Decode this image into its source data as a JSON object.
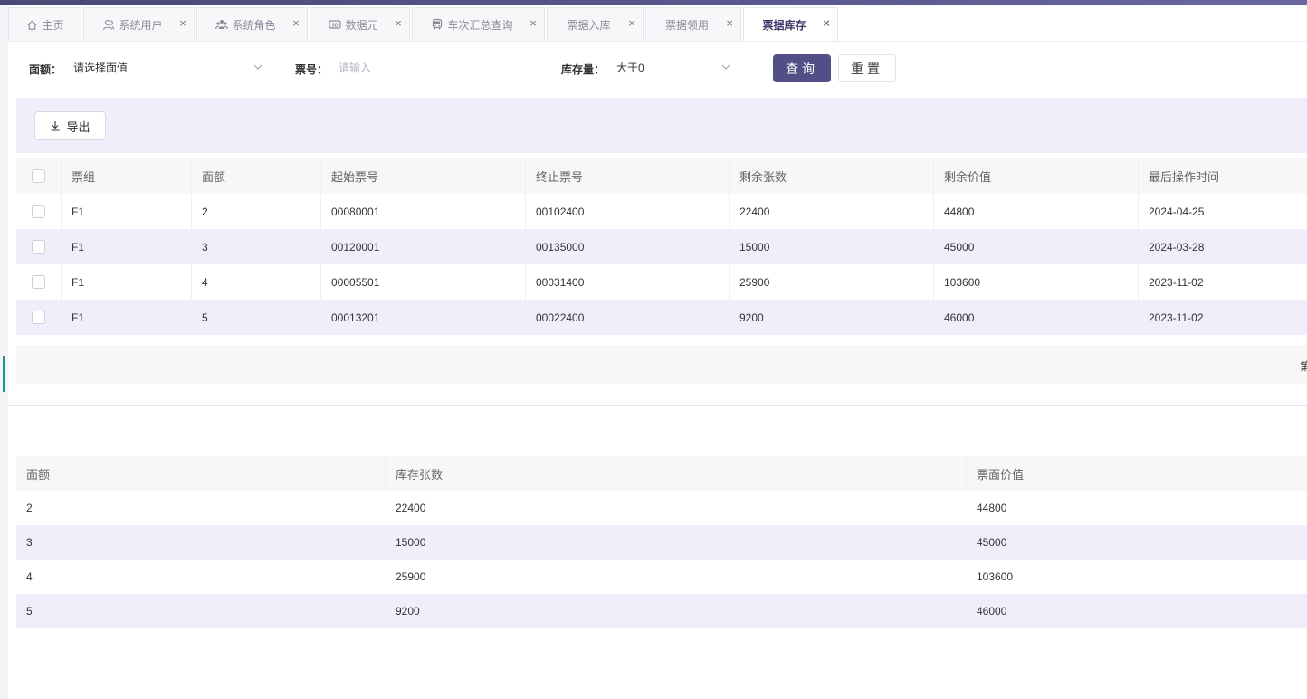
{
  "tabs": [
    {
      "label": "主页",
      "icon": "home-icon",
      "closable": false,
      "active": false
    },
    {
      "label": "系统用户",
      "icon": "user-icon",
      "closable": true,
      "active": false
    },
    {
      "label": "系统角色",
      "icon": "users-icon",
      "closable": true,
      "active": false
    },
    {
      "label": "数据元",
      "icon": "sd-card-icon",
      "closable": true,
      "active": false
    },
    {
      "label": "车次汇总查询",
      "icon": "train-icon",
      "closable": true,
      "active": false
    },
    {
      "label": "票据入库",
      "icon": "",
      "closable": true,
      "active": false
    },
    {
      "label": "票据领用",
      "icon": "",
      "closable": true,
      "active": false
    },
    {
      "label": "票据库存",
      "icon": "",
      "closable": true,
      "active": true
    }
  ],
  "close_glyph": "×",
  "filters": {
    "denomination_label": "面额：",
    "denomination_value": "请选择面值",
    "ticket_no_label": "票号：",
    "ticket_no_placeholder": "请输入",
    "stock_label": "库存量：",
    "stock_value": "大于0",
    "query_button": "查询",
    "reset_button": "重置"
  },
  "toolbar": {
    "export_button": "导出"
  },
  "stock_table": {
    "headers": [
      "票组",
      "面额",
      "起始票号",
      "终止票号",
      "剩余张数",
      "剩余价值",
      "最后操作时间"
    ],
    "rows": [
      [
        "F1",
        "2",
        "00080001",
        "00102400",
        "22400",
        "44800",
        "2024-04-25"
      ],
      [
        "F1",
        "3",
        "00120001",
        "00135000",
        "15000",
        "45000",
        "2024-03-28"
      ],
      [
        "F1",
        "4",
        "00005501",
        "00031400",
        "25900",
        "103600",
        "2023-11-02"
      ],
      [
        "F1",
        "5",
        "00013201",
        "00022400",
        "9200",
        "46000",
        "2023-11-02"
      ]
    ]
  },
  "pager": {
    "text": "第"
  },
  "summary_table": {
    "headers": [
      "面额",
      "库存张数",
      "票面价值"
    ],
    "rows": [
      [
        "2",
        "22400",
        "44800"
      ],
      [
        "3",
        "15000",
        "45000"
      ],
      [
        "4",
        "25900",
        "103600"
      ],
      [
        "5",
        "9200",
        "46000"
      ]
    ]
  },
  "colors": {
    "accent": "#524f86",
    "row_alt": "#efeefa",
    "header_bg": "#f7f7f7",
    "marker": "#1a9a7d"
  }
}
